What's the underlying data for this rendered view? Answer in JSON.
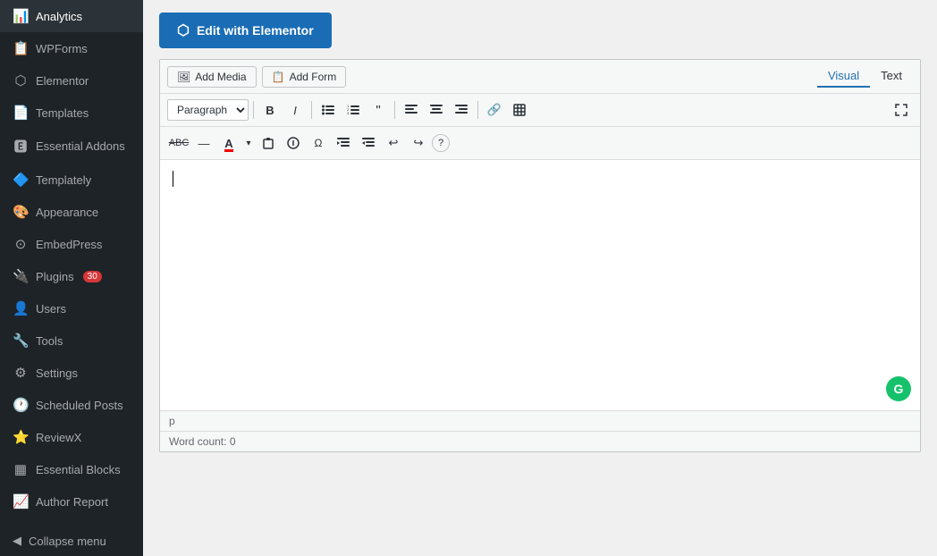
{
  "sidebar": {
    "items": [
      {
        "id": "analytics",
        "label": "Analytics",
        "icon": "📊"
      },
      {
        "id": "wpforms",
        "label": "WPForms",
        "icon": "📋"
      },
      {
        "id": "elementor",
        "label": "Elementor",
        "icon": "⬡"
      },
      {
        "id": "templates",
        "label": "Templates",
        "icon": "📄"
      },
      {
        "id": "essential-addons",
        "label": "Essential Addons",
        "icon": "🅴"
      },
      {
        "id": "templately",
        "label": "Templately",
        "icon": "🔷"
      },
      {
        "id": "appearance",
        "label": "Appearance",
        "icon": "🎨"
      },
      {
        "id": "embedpress",
        "label": "EmbedPress",
        "icon": "⊙"
      },
      {
        "id": "plugins",
        "label": "Plugins",
        "icon": "🔌",
        "badge": "30"
      },
      {
        "id": "users",
        "label": "Users",
        "icon": "👤"
      },
      {
        "id": "tools",
        "label": "Tools",
        "icon": "🔧"
      },
      {
        "id": "settings",
        "label": "Settings",
        "icon": "⚙"
      },
      {
        "id": "scheduled-posts",
        "label": "Scheduled Posts",
        "icon": "🕐"
      },
      {
        "id": "reviewx",
        "label": "ReviewX",
        "icon": "⭐"
      },
      {
        "id": "essential-blocks",
        "label": "Essential Blocks",
        "icon": "▦"
      },
      {
        "id": "author-report",
        "label": "Author Report",
        "icon": "📈"
      }
    ],
    "collapse_label": "Collapse menu",
    "collapse_icon": "◀"
  },
  "header": {
    "edit_elementor_label": "Edit with Elementor",
    "elementor_icon": "⬡"
  },
  "media_toolbar": {
    "add_media_label": "Add Media",
    "add_form_label": "Add Form",
    "media_icon": "🖼",
    "form_icon": "📋"
  },
  "view_tabs": {
    "visual_label": "Visual",
    "text_label": "Text",
    "active": "visual"
  },
  "format_toolbar": {
    "paragraph_label": "Paragraph",
    "buttons": [
      {
        "id": "bold",
        "label": "B",
        "title": "Bold"
      },
      {
        "id": "italic",
        "label": "I",
        "title": "Italic"
      },
      {
        "id": "ul",
        "label": "≡",
        "title": "Unordered List"
      },
      {
        "id": "ol",
        "label": "≡",
        "title": "Ordered List"
      },
      {
        "id": "blockquote",
        "label": "❝",
        "title": "Blockquote"
      },
      {
        "id": "align-left",
        "label": "⬡",
        "title": "Align Left"
      },
      {
        "id": "align-center",
        "label": "☰",
        "title": "Align Center"
      },
      {
        "id": "align-right",
        "label": "☰",
        "title": "Align Right"
      },
      {
        "id": "link",
        "label": "🔗",
        "title": "Insert Link"
      },
      {
        "id": "table",
        "label": "⊞",
        "title": "Table"
      },
      {
        "id": "grid",
        "label": "⊟",
        "title": "Grid"
      }
    ]
  },
  "format_toolbar2": {
    "buttons": [
      {
        "id": "strikethrough",
        "label": "abc̶",
        "title": "Strikethrough"
      },
      {
        "id": "hr",
        "label": "—",
        "title": "Horizontal Rule"
      },
      {
        "id": "color",
        "label": "A",
        "title": "Text Color"
      },
      {
        "id": "paste-text",
        "label": "📋",
        "title": "Paste as Text"
      },
      {
        "id": "remove-format",
        "label": "◌",
        "title": "Remove Format"
      },
      {
        "id": "special-char",
        "label": "Ω",
        "title": "Special Characters"
      },
      {
        "id": "indent",
        "label": "⇥",
        "title": "Indent"
      },
      {
        "id": "outdent",
        "label": "⇤",
        "title": "Outdent"
      },
      {
        "id": "undo",
        "label": "↩",
        "title": "Undo"
      },
      {
        "id": "redo",
        "label": "↪",
        "title": "Redo"
      },
      {
        "id": "help",
        "label": "?",
        "title": "Help"
      }
    ]
  },
  "editor": {
    "status_tag": "p",
    "word_count_label": "Word count:",
    "word_count_value": "0",
    "grammarly_letter": "G"
  }
}
